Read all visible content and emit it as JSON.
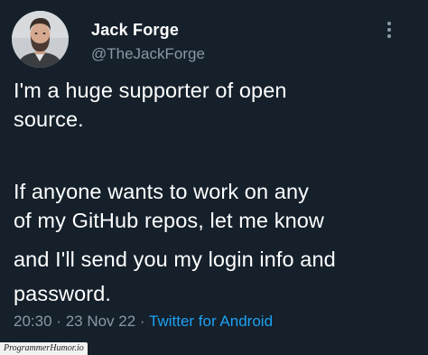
{
  "user": {
    "display_name": "Jack Forge",
    "handle": "@TheJackForge",
    "avatar_icon": "profile-photo"
  },
  "tweet": {
    "lines": [
      "I'm a huge supporter of open",
      "source.",
      "If anyone wants to work on any",
      "of my GitHub repos, let me know",
      "and I'll send you my login info and",
      "password."
    ]
  },
  "meta": {
    "time": "20:30",
    "separator": "·",
    "date": "23 Nov 22",
    "source": "Twitter for Android"
  },
  "watermark": "ProgrammerHumor.io",
  "colors": {
    "background": "#15202b",
    "text": "#ffffff",
    "secondary": "#8899a6",
    "link": "#1da1f2"
  },
  "icons": {
    "more": "more-vertical-icon"
  }
}
